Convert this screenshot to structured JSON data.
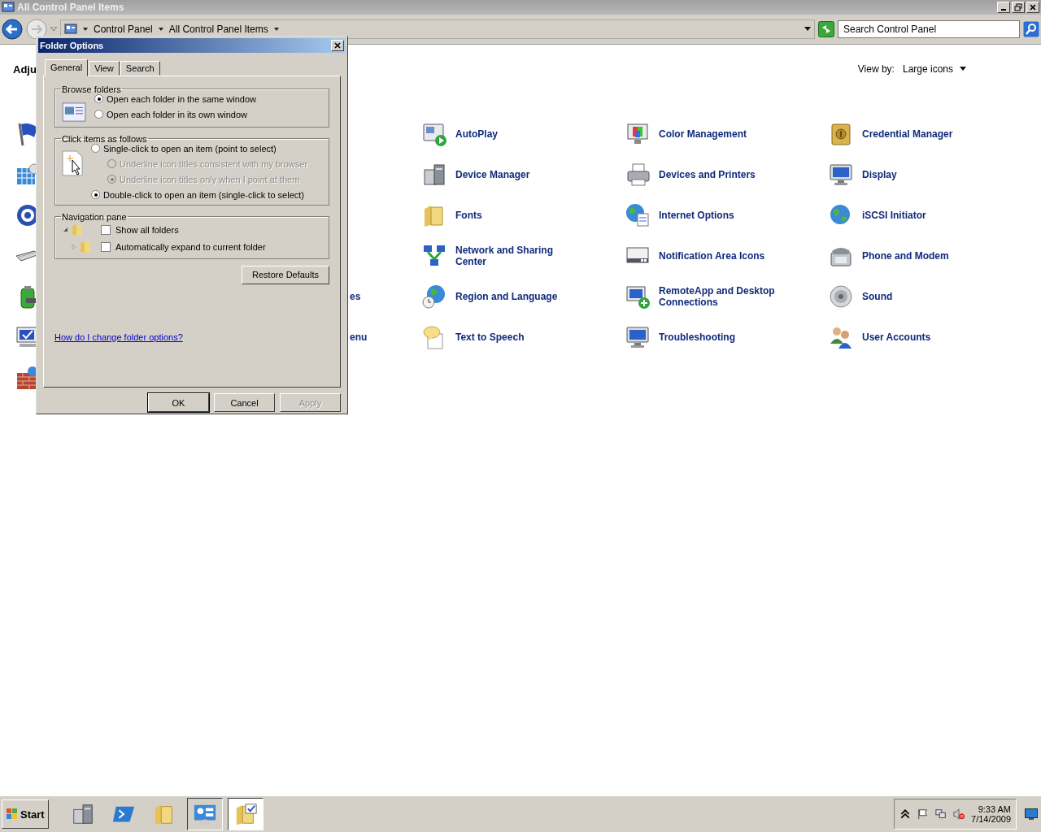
{
  "window": {
    "title": "All Control Panel Items"
  },
  "address": {
    "breadcrumbs": [
      "Control Panel",
      "All Control Panel Items"
    ],
    "search": {
      "placeholder": "Search Control Panel"
    }
  },
  "content": {
    "heading": "Adju",
    "view_by": {
      "label": "View by:",
      "value": "Large icons"
    },
    "rows": [
      {
        "items": [
          "AutoPlay",
          "Color Management",
          "Credential Manager"
        ]
      },
      {
        "items": [
          "Device Manager",
          "Devices and Printers",
          "Display"
        ]
      },
      {
        "items": [
          "Fonts",
          "Internet Options",
          "iSCSI Initiator"
        ]
      },
      {
        "items": [
          "Network and Sharing Center",
          "Notification Area Icons",
          "Phone and Modem"
        ]
      },
      {
        "cut_label": "es",
        "items": [
          "Region and Language",
          "RemoteApp and Desktop Connections",
          "Sound"
        ]
      },
      {
        "cut_label": "enu",
        "items": [
          "Text to Speech",
          "Troubleshooting",
          "User Accounts"
        ]
      },
      {
        "items": []
      }
    ]
  },
  "dialog": {
    "title": "Folder Options",
    "tabs": [
      {
        "label": "General",
        "selected": true
      },
      {
        "label": "View",
        "selected": false
      },
      {
        "label": "Search",
        "selected": false
      }
    ],
    "browse": {
      "title": "Browse folders",
      "options": [
        {
          "label": "Open each folder in the same window",
          "selected": true,
          "disabled": false
        },
        {
          "label": "Open each folder in its own window",
          "selected": false,
          "disabled": false
        }
      ]
    },
    "click": {
      "title": "Click items as follows",
      "options": [
        {
          "label": "Single-click to open an item (point to select)",
          "selected": false,
          "disabled": false,
          "children": [
            {
              "label": "Underline icon titles consistent with my browser",
              "selected": false,
              "disabled": true
            },
            {
              "label": "Underline icon titles only when I point at them",
              "selected": true,
              "disabled": true
            }
          ]
        },
        {
          "label": "Double-click to open an item (single-click to select)",
          "selected": true,
          "disabled": false
        }
      ]
    },
    "navigation": {
      "title": "Navigation pane",
      "options": [
        {
          "label": "Show all folders",
          "checked": false
        },
        {
          "label": "Automatically expand to current folder",
          "checked": false
        }
      ]
    },
    "restore_button": "Restore Defaults",
    "help_link": "How do I change folder options?",
    "buttons": [
      {
        "label": "OK",
        "disabled": false,
        "default": true
      },
      {
        "label": "Cancel",
        "disabled": false,
        "default": false
      },
      {
        "label": "Apply",
        "disabled": true,
        "default": false
      }
    ]
  },
  "taskbar": {
    "start": "Start",
    "apps": [
      {
        "selected": false,
        "open": false
      },
      {
        "selected": false,
        "open": false
      },
      {
        "selected": false,
        "open": false
      },
      {
        "selected": false,
        "open": true
      },
      {
        "selected": true,
        "open": true
      }
    ],
    "time": "9:33 AM",
    "date": "7/14/2009"
  }
}
